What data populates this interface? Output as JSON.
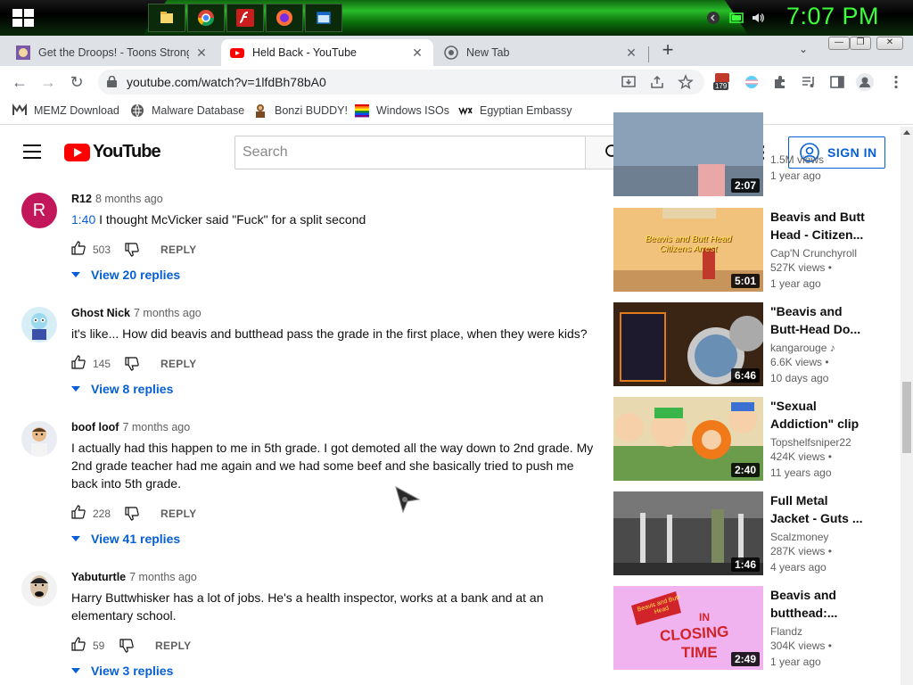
{
  "taskbar": {
    "clock": "7:07 PM",
    "apps": [
      "file-explorer-icon",
      "chrome-icon",
      "flash-icon",
      "firefox-icon",
      "window-icon"
    ]
  },
  "browser": {
    "tabs": [
      {
        "title": "Get the Droops! - Toons Strong B",
        "active": false
      },
      {
        "title": "Held Back - YouTube",
        "active": true
      },
      {
        "title": "New Tab",
        "active": false
      }
    ],
    "url": "youtube.com/watch?v=1lfdBh78bA0",
    "badge_count": "179",
    "bookmarks": [
      "MEMZ Download",
      "Malware Database",
      "Bonzi BUDDY!",
      "Windows ISOs",
      "Egyptian Embassy"
    ]
  },
  "youtube": {
    "logo_text": "YouTube",
    "search_placeholder": "Search",
    "sign_in": "SIGN IN"
  },
  "comments": [
    {
      "author": "R12",
      "time": "8 months ago",
      "timestamp": "1:40",
      "text": " I thought McVicker said \"Fuck\" for a split second",
      "likes": "503",
      "reply": "REPLY",
      "replies": "View 20 replies",
      "avatar_letter": "R"
    },
    {
      "author": "Ghost Nick",
      "time": "7 months ago",
      "timestamp": "",
      "text": "it's like... How did beavis and butthead pass the grade in the first place, when they were kids?",
      "likes": "145",
      "reply": "REPLY",
      "replies": "View 8 replies"
    },
    {
      "author": "boof loof",
      "time": "7 months ago",
      "timestamp": "",
      "text": "I actually had this happen to me in 5th grade. I got demoted all the way down to 2nd grade. My 2nd grade teacher had me again and we had some beef and she basically tried to push me back into 5th grade.",
      "likes": "228",
      "reply": "REPLY",
      "replies": "View 41 replies"
    },
    {
      "author": "Yabuturtle",
      "time": "7 months ago",
      "timestamp": "",
      "text": "Harry Buttwhisker has a lot of jobs. He's a health inspector, works at a bank and at an elementary school.",
      "likes": "59",
      "reply": "REPLY",
      "replies": "View 3 replies"
    }
  ],
  "recommendations": [
    {
      "title": "",
      "channel": "",
      "views": "1.5M views",
      "age": "1 year ago",
      "duration": "2:07"
    },
    {
      "title": "Beavis and Butt Head - Citizen...",
      "channel": "Cap'N Crunchyroll",
      "views": "527K views",
      "age": "1 year ago",
      "duration": "5:01",
      "thumb_text": "Beavis and Butt Head Citizens Arrest"
    },
    {
      "title": "\"Beavis and Butt-Head Do...",
      "channel": "kangarouge",
      "views": "6.6K views",
      "age": "10 days ago",
      "duration": "6:46"
    },
    {
      "title": "\"Sexual Addiction\" clip",
      "channel": "Topshelfsniper22",
      "views": "424K views",
      "age": "11 years ago",
      "duration": "2:40"
    },
    {
      "title": "Full Metal Jacket - Guts ...",
      "channel": "Scalzmoney",
      "views": "287K views",
      "age": "4 years ago",
      "duration": "1:46"
    },
    {
      "title": "Beavis and butthead:...",
      "channel": "Flandz",
      "views": "304K views",
      "age": "1 year ago",
      "duration": "2:49",
      "thumb_text_1": "Beavis and Butt-Head",
      "thumb_text_2": "IN",
      "thumb_text_3": "CLOSING",
      "thumb_text_4": "TIME"
    }
  ],
  "colors": {
    "accent": "#065fd4",
    "youtube_red": "#ff0000",
    "clock_green": "#3cff3c"
  }
}
